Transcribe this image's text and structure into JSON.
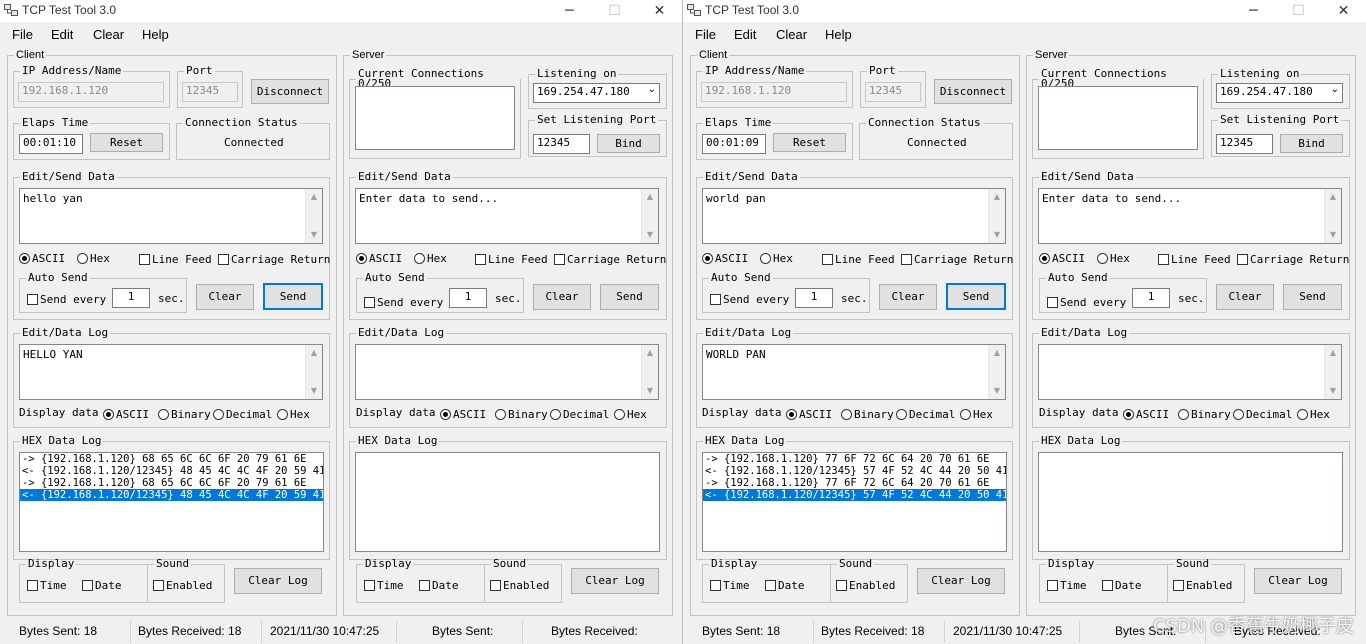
{
  "windows": [
    {
      "title": "TCP Test Tool 3.0",
      "menu": [
        "File",
        "Edit",
        "Clear",
        "Help"
      ],
      "client": {
        "group_label": "Client",
        "ip_label": "IP Address/Name",
        "ip_value": "192.168.1.120",
        "port_label": "Port",
        "port_value": "12345",
        "disconnect_label": "Disconnect",
        "elaps_label": "Elaps Time",
        "elaps_value": "00:01:10",
        "reset_label": "Reset",
        "conn_status_label": "Connection Status",
        "conn_status_value": "Connected",
        "edit_send_label": "Edit/Send Data",
        "send_text": "hello yan",
        "ascii": "ASCII",
        "hex": "Hex",
        "line_feed": "Line Feed",
        "carriage_return": "Carriage Return",
        "auto_send_label": "Auto Send",
        "send_every": "Send every",
        "send_every_value": "1",
        "sec": "sec.",
        "clear_label": "Clear",
        "send_label": "Send",
        "data_log_label": "Edit/Data Log",
        "data_log_text": "HELLO YAN",
        "display_data": "Display data",
        "binary": "Binary",
        "decimal": "Decimal",
        "hex_log_label": "HEX Data Log",
        "hex_log_lines": [
          "-> {192.168.1.120} 68 65 6C 6C 6F 20 79 61 6E",
          "<- {192.168.1.120/12345} 48 45 4C 4C 4F 20 59 41 4",
          "-> {192.168.1.120} 68 65 6C 6C 6F 20 79 61 6E",
          "<- {192.168.1.120/12345} 48 45 4C 4C 4F 20 59 41 4"
        ],
        "display_group": "Display",
        "time": "Time",
        "date": "Date",
        "sound_group": "Sound",
        "enabled": "Enabled",
        "clear_log": "Clear Log"
      },
      "server": {
        "group_label": "Server",
        "current_connections": "Current Connections 0/250",
        "listening_on": "Listening on",
        "listening_value": "169.254.47.180",
        "set_port_label": "Set Listening Port",
        "port_value": "12345",
        "bind_label": "Bind",
        "edit_send_label": "Edit/Send Data",
        "send_placeholder": "Enter data to send...",
        "ascii": "ASCII",
        "hex": "Hex",
        "line_feed": "Line Feed",
        "carriage_return": "Carriage Return",
        "auto_send_label": "Auto Send",
        "send_every": "Send every",
        "send_every_value": "1",
        "sec": "sec.",
        "clear_label": "Clear",
        "send_label": "Send",
        "data_log_label": "Edit/Data Log",
        "display_data": "Display data",
        "binary": "Binary",
        "decimal": "Decimal",
        "hex_log_label": "HEX Data Log",
        "display_group": "Display",
        "time": "Time",
        "date": "Date",
        "sound_group": "Sound",
        "enabled": "Enabled",
        "clear_log": "Clear Log"
      },
      "status": {
        "bytes_sent": "Bytes Sent: 18",
        "bytes_received": "Bytes Received: 18",
        "datetime": "2021/11/30 10:47:25",
        "server_bytes_sent": "Bytes Sent:",
        "server_bytes_received": "Bytes Received:"
      }
    },
    {
      "title": "TCP Test Tool 3.0",
      "menu": [
        "File",
        "Edit",
        "Clear",
        "Help"
      ],
      "client": {
        "group_label": "Client",
        "ip_label": "IP Address/Name",
        "ip_value": "192.168.1.120",
        "port_label": "Port",
        "port_value": "12345",
        "disconnect_label": "Disconnect",
        "elaps_label": "Elaps Time",
        "elaps_value": "00:01:09",
        "reset_label": "Reset",
        "conn_status_label": "Connection Status",
        "conn_status_value": "Connected",
        "edit_send_label": "Edit/Send Data",
        "send_text": "world pan",
        "ascii": "ASCII",
        "hex": "Hex",
        "line_feed": "Line Feed",
        "carriage_return": "Carriage Return",
        "auto_send_label": "Auto Send",
        "send_every": "Send every",
        "send_every_value": "1",
        "sec": "sec.",
        "clear_label": "Clear",
        "send_label": "Send",
        "data_log_label": "Edit/Data Log",
        "data_log_text": "WORLD PAN",
        "display_data": "Display data",
        "binary": "Binary",
        "decimal": "Decimal",
        "hex_log_label": "HEX Data Log",
        "hex_log_lines": [
          "-> {192.168.1.120} 77 6F 72 6C 64 20 70 61 6E",
          "<- {192.168.1.120/12345} 57 4F 52 4C 44 20 50 41 4",
          "-> {192.168.1.120} 77 6F 72 6C 64 20 70 61 6E",
          "<- {192.168.1.120/12345} 57 4F 52 4C 44 20 50 41 4"
        ],
        "display_group": "Display",
        "time": "Time",
        "date": "Date",
        "sound_group": "Sound",
        "enabled": "Enabled",
        "clear_log": "Clear Log"
      },
      "server": {
        "group_label": "Server",
        "current_connections": "Current Connections 0/250",
        "listening_on": "Listening on",
        "listening_value": "169.254.47.180",
        "set_port_label": "Set Listening Port",
        "port_value": "12345",
        "bind_label": "Bind",
        "edit_send_label": "Edit/Send Data",
        "send_placeholder": "Enter data to send...",
        "ascii": "ASCII",
        "hex": "Hex",
        "line_feed": "Line Feed",
        "carriage_return": "Carriage Return",
        "auto_send_label": "Auto Send",
        "send_every": "Send every",
        "send_every_value": "1",
        "sec": "sec.",
        "clear_label": "Clear",
        "send_label": "Send",
        "data_log_label": "Edit/Data Log",
        "display_data": "Display data",
        "binary": "Binary",
        "decimal": "Decimal",
        "hex_log_label": "HEX Data Log",
        "display_group": "Display",
        "time": "Time",
        "date": "Date",
        "sound_group": "Sound",
        "enabled": "Enabled",
        "clear_log": "Clear Log"
      },
      "status": {
        "bytes_sent": "Bytes Sent: 18",
        "bytes_received": "Bytes Received: 18",
        "datetime": "2021/11/30 10:47:25",
        "server_bytes_sent": "Bytes Sent:",
        "server_bytes_received": "Bytes Received:"
      }
    }
  ],
  "watermark": "CSDN @香蕉牛奶椰子皮",
  "colors": {
    "selection": "#0078d7",
    "focus_border": "#0078d7",
    "window_bg": "#f0f0f0"
  }
}
